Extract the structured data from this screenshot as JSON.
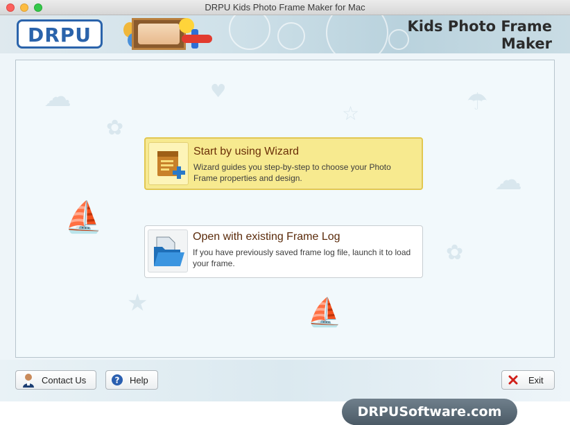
{
  "window": {
    "title": "DRPU Kids Photo Frame Maker for Mac"
  },
  "header": {
    "logo_text": "DRPU",
    "app_name_line1": "Kids Photo Frame",
    "app_name_line2": "Maker"
  },
  "options": [
    {
      "title": "Start by using Wizard",
      "description": "Wizard guides you step-by-step to choose your Photo Frame properties and design.",
      "icon": "wizard-document-plus-icon",
      "selected": true
    },
    {
      "title": "Open with existing Frame Log",
      "description": "If you have previously saved frame log file, launch it to load your frame.",
      "icon": "folder-open-icon",
      "selected": false
    }
  ],
  "footer": {
    "contact_label": "Contact Us",
    "help_label": "Help",
    "exit_label": "Exit"
  },
  "website": "DRPUSoftware.com",
  "colors": {
    "brand_blue": "#2a63ab",
    "wizard_highlight": "#f7ea8f",
    "exit_red": "#d0201a",
    "title_brown": "#6a2f08"
  }
}
